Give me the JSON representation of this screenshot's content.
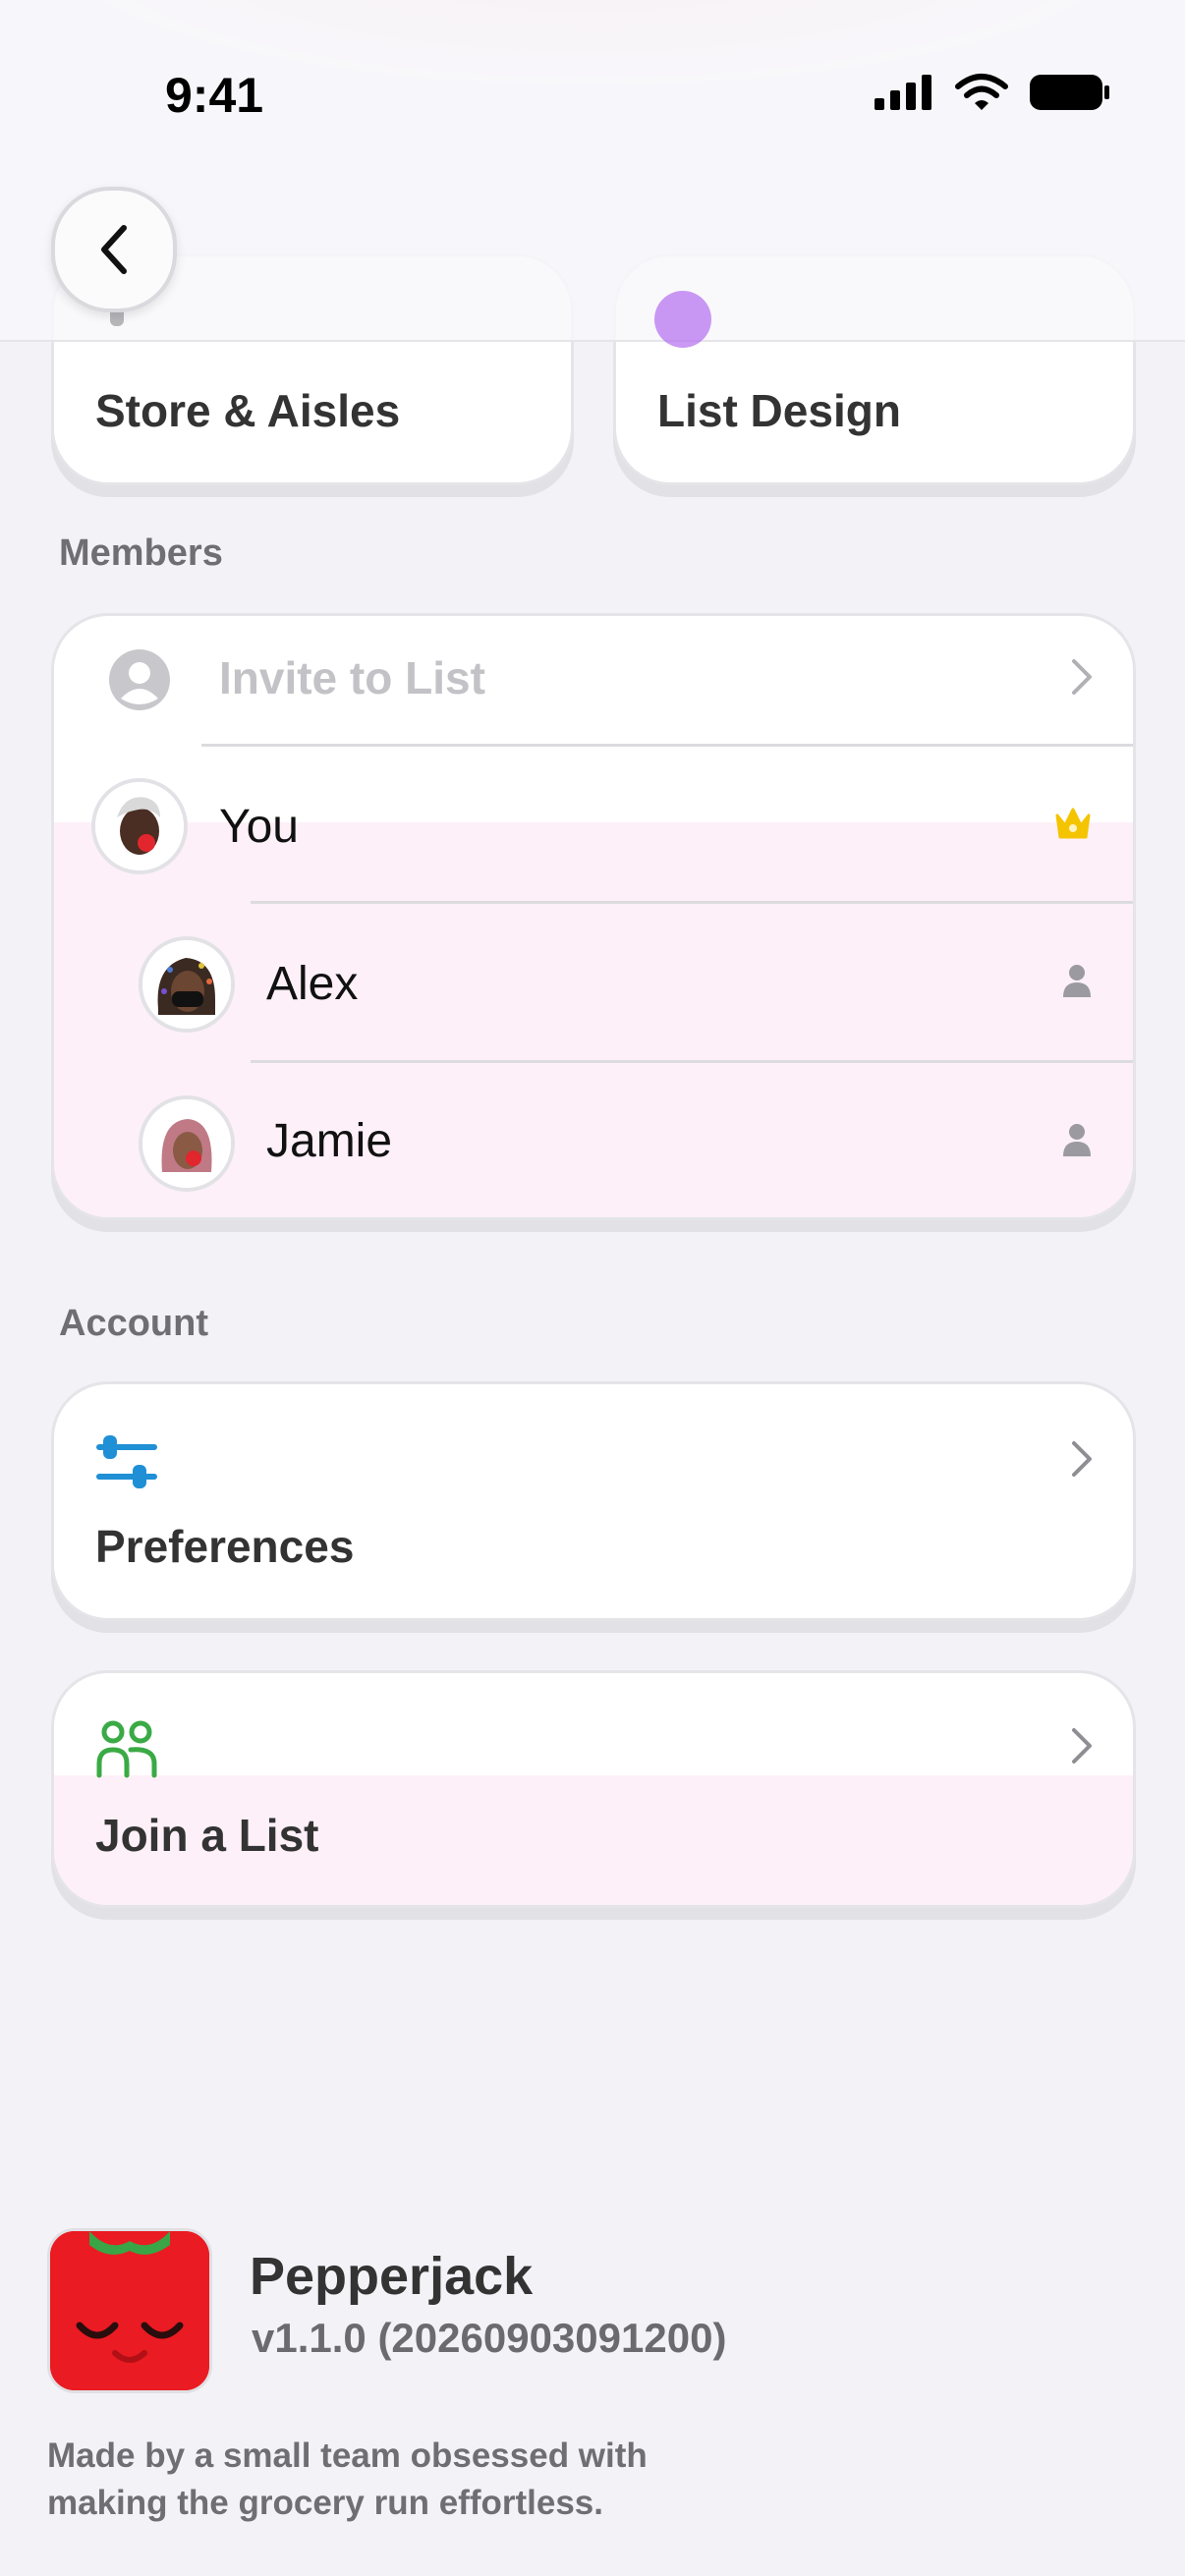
{
  "status_bar": {
    "time": "9:41"
  },
  "nav": {
    "back_icon": "chevron-left-icon"
  },
  "tiles": [
    {
      "label": "Store & Aisles",
      "icon": "store-icon"
    },
    {
      "label": "List Design",
      "icon": "palette-icon"
    }
  ],
  "members": {
    "title": "Members",
    "invite_label": "Invite to List",
    "list": [
      {
        "name": "You",
        "role_icon": "crown-icon"
      },
      {
        "name": "Alex",
        "role_icon": "person-icon"
      },
      {
        "name": "Jamie",
        "role_icon": "person-icon"
      }
    ]
  },
  "account": {
    "title": "Account",
    "preferences_label": "Preferences",
    "join_label": "Join a List"
  },
  "footer": {
    "app_name": "Pepperjack",
    "version": "v1.1.0 (20260903091200)",
    "tagline": "Made by a small team obsessed with making the grocery run effortless."
  },
  "colors": {
    "accent_pink": "#fdf0f8",
    "crown": "#f5c400",
    "preferences_icon": "#1f8fd6",
    "join_icon": "#3aaa45"
  }
}
